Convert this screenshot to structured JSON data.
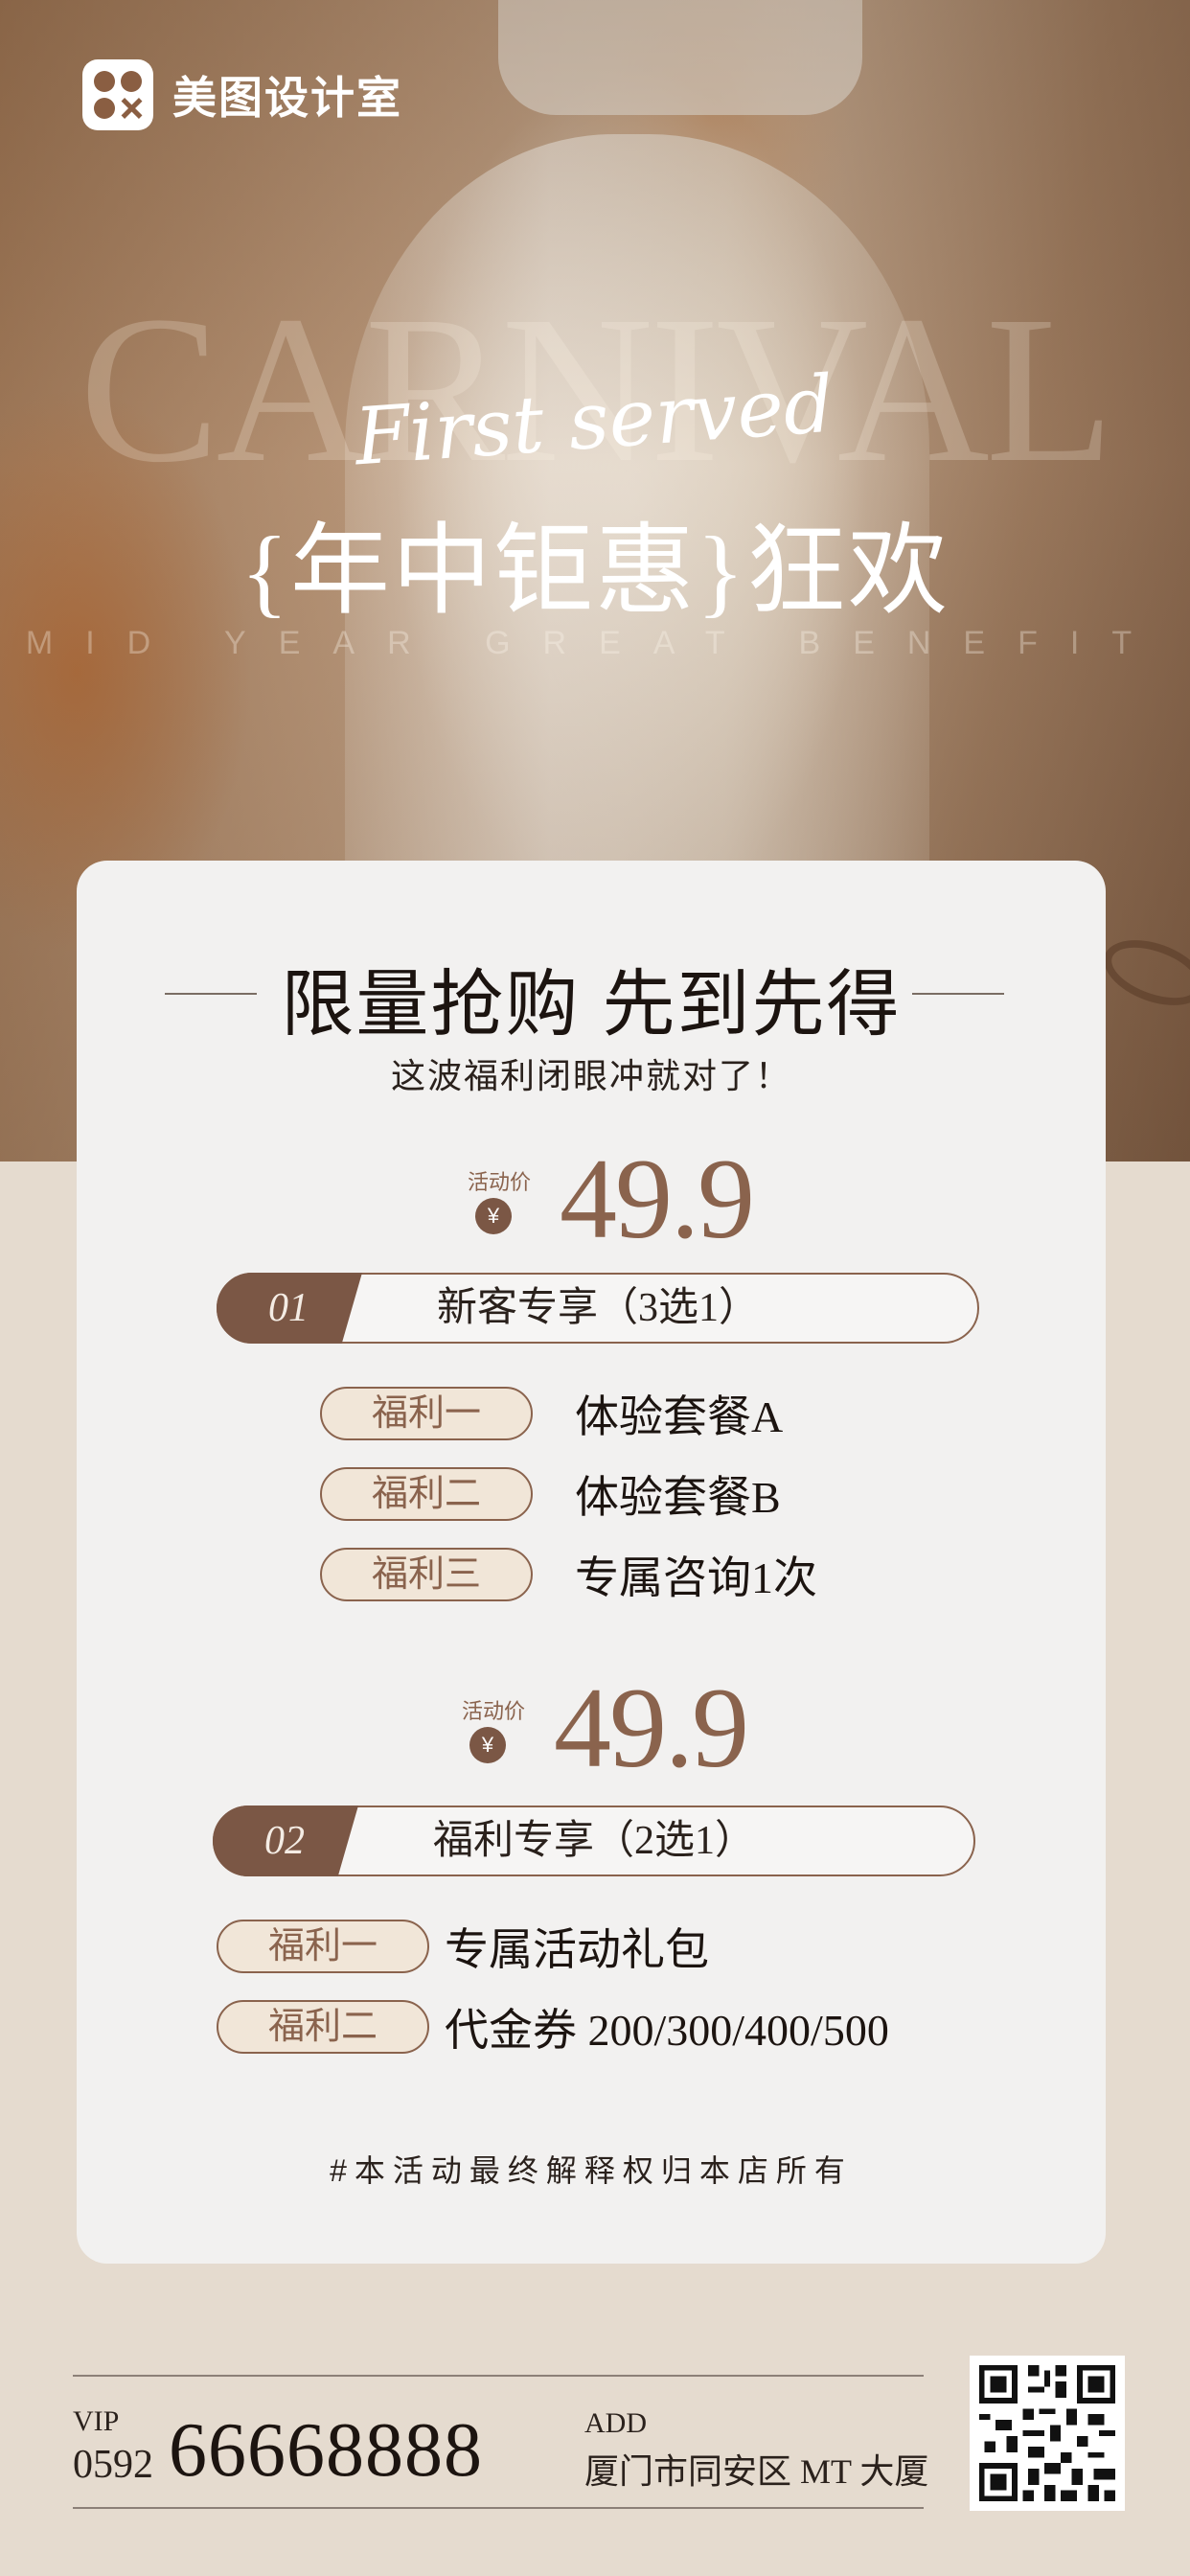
{
  "brand": {
    "name": "美图设计室",
    "icon": "meitu-logo-icon"
  },
  "hero": {
    "watermark": "CARNIVAL",
    "script": "First served",
    "headline": "{年中钜惠}狂欢",
    "tagline": "MID YEAR GREAT BENEFIT"
  },
  "card": {
    "title": "限量抢购 先到先得",
    "subtitle": "这波福利闭眼冲就对了！",
    "packages": [
      {
        "price_label": "活动价",
        "currency": "¥",
        "price": "49.9",
        "number": "01",
        "title": "新客专享（3选1）",
        "perks": [
          {
            "tag": "福利一",
            "text": "体验套餐A"
          },
          {
            "tag": "福利二",
            "text": "体验套餐B"
          },
          {
            "tag": "福利三",
            "text": "专属咨询1次"
          }
        ]
      },
      {
        "price_label": "活动价",
        "currency": "¥",
        "price": "49.9",
        "number": "02",
        "title": "福利专享（2选1）",
        "perks": [
          {
            "tag": "福利一",
            "text": "专属活动礼包"
          },
          {
            "tag": "福利二",
            "text": "代金券 200/300/400/500"
          }
        ]
      }
    ],
    "disclaimer": "#本活动最终解释权归本店所有"
  },
  "footer": {
    "vip_label": "VIP",
    "phone_prefix": "0592",
    "phone": "66668888",
    "add_label": "ADD",
    "address": "厦门市同安区 MT 大厦",
    "qr": "qr-code-icon"
  },
  "colors": {
    "accent": "#7b5745",
    "tag_fill": "#f1e6d8",
    "card": "#f2f1f0",
    "background": "#e5dbcf"
  }
}
